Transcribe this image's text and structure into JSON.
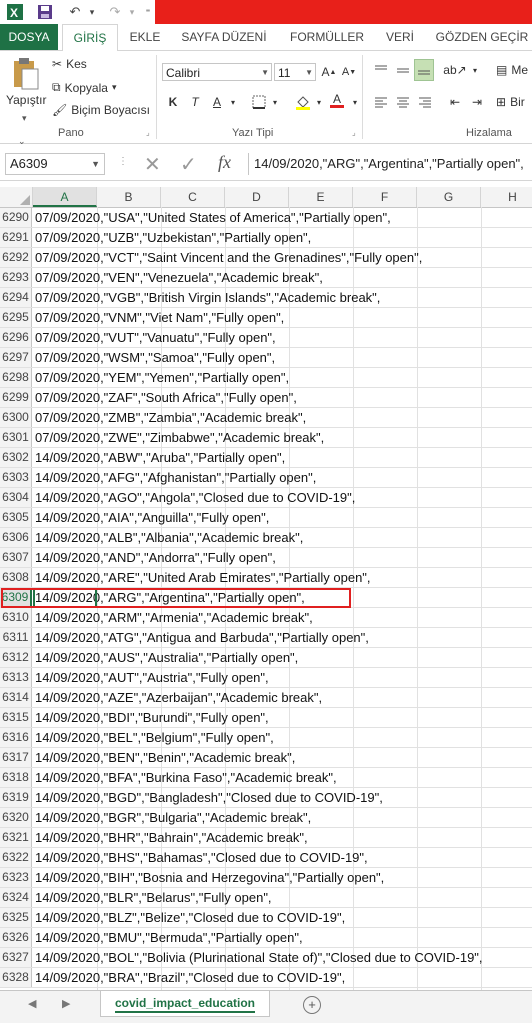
{
  "ribbon_tabs": {
    "file": "DOSYA",
    "home": "GİRİŞ",
    "insert": "EKLE",
    "page_layout": "SAYFA DÜZENİ",
    "formulas": "FORMÜLLER",
    "data": "VERİ",
    "review": "GÖZDEN GEÇİR"
  },
  "clipboard": {
    "paste": "Yapıştır",
    "cut": "Kes",
    "copy": "Kopyala",
    "format_painter": "Biçim Boyacısı",
    "group": "Pano"
  },
  "font": {
    "name": "Calibri",
    "size": "11",
    "group": "Yazı Tipi",
    "bold": "K",
    "italic": "T",
    "underline": "A"
  },
  "alignment": {
    "group": "Hizalama",
    "wrap_partial": "Me",
    "merge_partial": "Bir"
  },
  "formula_bar": {
    "name_box": "A6309",
    "fx": "fx",
    "content": "14/09/2020,\"ARG\",\"Argentina\",\"Partially open\","
  },
  "columns": [
    "A",
    "B",
    "C",
    "D",
    "E",
    "F",
    "G",
    "H"
  ],
  "selected_row": "6309",
  "rows": [
    {
      "n": "6290",
      "text": "07/09/2020,\"USA\",\"United States of America\",\"Partially open\","
    },
    {
      "n": "6291",
      "text": "07/09/2020,\"UZB\",\"Uzbekistan\",\"Partially open\","
    },
    {
      "n": "6292",
      "text": "07/09/2020,\"VCT\",\"Saint Vincent and the Grenadines\",\"Fully open\","
    },
    {
      "n": "6293",
      "text": "07/09/2020,\"VEN\",\"Venezuela\",\"Academic break\","
    },
    {
      "n": "6294",
      "text": "07/09/2020,\"VGB\",\"British Virgin Islands\",\"Academic break\","
    },
    {
      "n": "6295",
      "text": "07/09/2020,\"VNM\",\"Viet Nam\",\"Fully open\","
    },
    {
      "n": "6296",
      "text": "07/09/2020,\"VUT\",\"Vanuatu\",\"Fully open\","
    },
    {
      "n": "6297",
      "text": "07/09/2020,\"WSM\",\"Samoa\",\"Fully open\","
    },
    {
      "n": "6298",
      "text": "07/09/2020,\"YEM\",\"Yemen\",\"Partially open\","
    },
    {
      "n": "6299",
      "text": "07/09/2020,\"ZAF\",\"South Africa\",\"Fully open\","
    },
    {
      "n": "6300",
      "text": "07/09/2020,\"ZMB\",\"Zambia\",\"Academic break\","
    },
    {
      "n": "6301",
      "text": "07/09/2020,\"ZWE\",\"Zimbabwe\",\"Academic break\","
    },
    {
      "n": "6302",
      "text": "14/09/2020,\"ABW\",\"Aruba\",\"Partially open\","
    },
    {
      "n": "6303",
      "text": "14/09/2020,\"AFG\",\"Afghanistan\",\"Partially open\","
    },
    {
      "n": "6304",
      "text": "14/09/2020,\"AGO\",\"Angola\",\"Closed due to COVID-19\","
    },
    {
      "n": "6305",
      "text": "14/09/2020,\"AIA\",\"Anguilla\",\"Fully open\","
    },
    {
      "n": "6306",
      "text": "14/09/2020,\"ALB\",\"Albania\",\"Academic break\","
    },
    {
      "n": "6307",
      "text": "14/09/2020,\"AND\",\"Andorra\",\"Fully open\","
    },
    {
      "n": "6308",
      "text": "14/09/2020,\"ARE\",\"United Arab Emirates\",\"Partially open\","
    },
    {
      "n": "6309",
      "text": "14/09/2020,\"ARG\",\"Argentina\",\"Partially open\","
    },
    {
      "n": "6310",
      "text": "14/09/2020,\"ARM\",\"Armenia\",\"Academic break\","
    },
    {
      "n": "6311",
      "text": "14/09/2020,\"ATG\",\"Antigua and Barbuda\",\"Partially open\","
    },
    {
      "n": "6312",
      "text": "14/09/2020,\"AUS\",\"Australia\",\"Partially open\","
    },
    {
      "n": "6313",
      "text": "14/09/2020,\"AUT\",\"Austria\",\"Fully open\","
    },
    {
      "n": "6314",
      "text": "14/09/2020,\"AZE\",\"Azerbaijan\",\"Academic break\","
    },
    {
      "n": "6315",
      "text": "14/09/2020,\"BDI\",\"Burundi\",\"Fully open\","
    },
    {
      "n": "6316",
      "text": "14/09/2020,\"BEL\",\"Belgium\",\"Fully open\","
    },
    {
      "n": "6317",
      "text": "14/09/2020,\"BEN\",\"Benin\",\"Academic break\","
    },
    {
      "n": "6318",
      "text": "14/09/2020,\"BFA\",\"Burkina Faso\",\"Academic break\","
    },
    {
      "n": "6319",
      "text": "14/09/2020,\"BGD\",\"Bangladesh\",\"Closed due to COVID-19\","
    },
    {
      "n": "6320",
      "text": "14/09/2020,\"BGR\",\"Bulgaria\",\"Academic break\","
    },
    {
      "n": "6321",
      "text": "14/09/2020,\"BHR\",\"Bahrain\",\"Academic break\","
    },
    {
      "n": "6322",
      "text": "14/09/2020,\"BHS\",\"Bahamas\",\"Closed due to COVID-19\","
    },
    {
      "n": "6323",
      "text": "14/09/2020,\"BIH\",\"Bosnia and Herzegovina\",\"Partially open\","
    },
    {
      "n": "6324",
      "text": "14/09/2020,\"BLR\",\"Belarus\",\"Fully open\","
    },
    {
      "n": "6325",
      "text": "14/09/2020,\"BLZ\",\"Belize\",\"Closed due to COVID-19\","
    },
    {
      "n": "6326",
      "text": "14/09/2020,\"BMU\",\"Bermuda\",\"Partially open\","
    },
    {
      "n": "6327",
      "text": "14/09/2020,\"BOL\",\"Bolivia (Plurinational State of)\",\"Closed due to COVID-19\","
    },
    {
      "n": "6328",
      "text": "14/09/2020,\"BRA\",\"Brazil\",\"Closed due to COVID-19\","
    }
  ],
  "sheet_tab": "covid_impact_education",
  "colors": {
    "accent": "#217346",
    "file_tab": "#1e7145",
    "title_red": "#e8201a",
    "highlight": "#e02020"
  }
}
